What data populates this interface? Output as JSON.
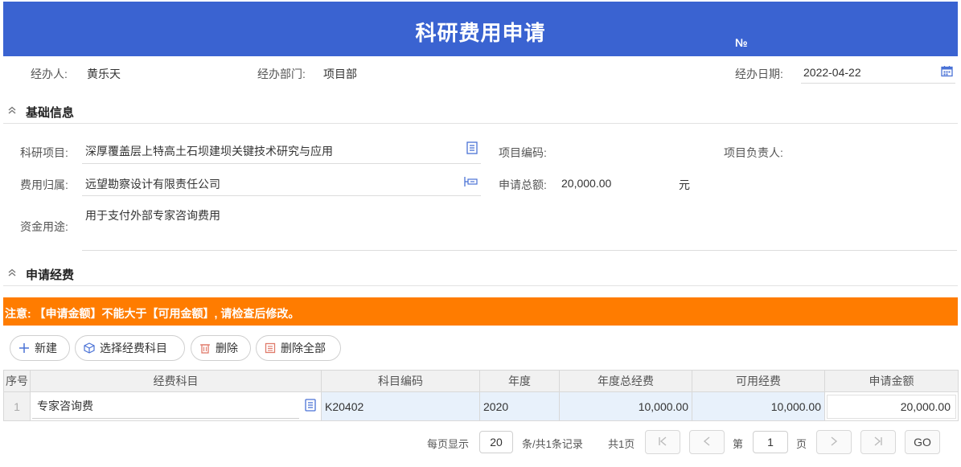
{
  "header": {
    "title": "科研费用申请",
    "no_label": "№"
  },
  "info": {
    "handler_label": "经办人:",
    "handler_value": "黄乐天",
    "dept_label": "经办部门:",
    "dept_value": "项目部",
    "date_label": "经办日期:",
    "date_value": "2022-04-22"
  },
  "basic": {
    "section_title": "基础信息",
    "project_label": "科研项目:",
    "project_value": "深厚覆盖层上特高土石坝建坝关键技术研究与应用",
    "code_label": "项目编码:",
    "owner_label": "项目负责人:",
    "cost_label": "费用归属:",
    "cost_value": "远望勘察设计有限责任公司",
    "total_label": "申请总额:",
    "total_value": "20,000.00",
    "total_unit": "元",
    "purpose_label": "资金用途:",
    "purpose_value": "用于支付外部专家咨询费用"
  },
  "apply": {
    "section_title": "申请经费",
    "warning": "注意: 【申请金额】不能大于【可用金额】, 请检查后修改。",
    "buttons": {
      "new": "新建",
      "select": "选择经费科目",
      "delete": "删除",
      "delete_all": "删除全部"
    },
    "columns": [
      "序号",
      "经费科目",
      "科目编码",
      "年度",
      "年度总经费",
      "可用经费",
      "申请金额"
    ],
    "rows": [
      {
        "idx": "1",
        "subject": "专家咨询费",
        "code": "K20402",
        "year": "2020",
        "total": "10,000.00",
        "available": "10,000.00",
        "amount": "20,000.00"
      }
    ]
  },
  "pager": {
    "per_page_label": "每页显示",
    "per_page": "20",
    "records": "条/共1条记录",
    "pages": "共1页",
    "page_prefix": "第",
    "page": "1",
    "page_suffix": "页",
    "go": "GO"
  },
  "colors": {
    "header": "#3a63d1",
    "warning": "#ff7c00",
    "row": "#e8f1fb"
  }
}
